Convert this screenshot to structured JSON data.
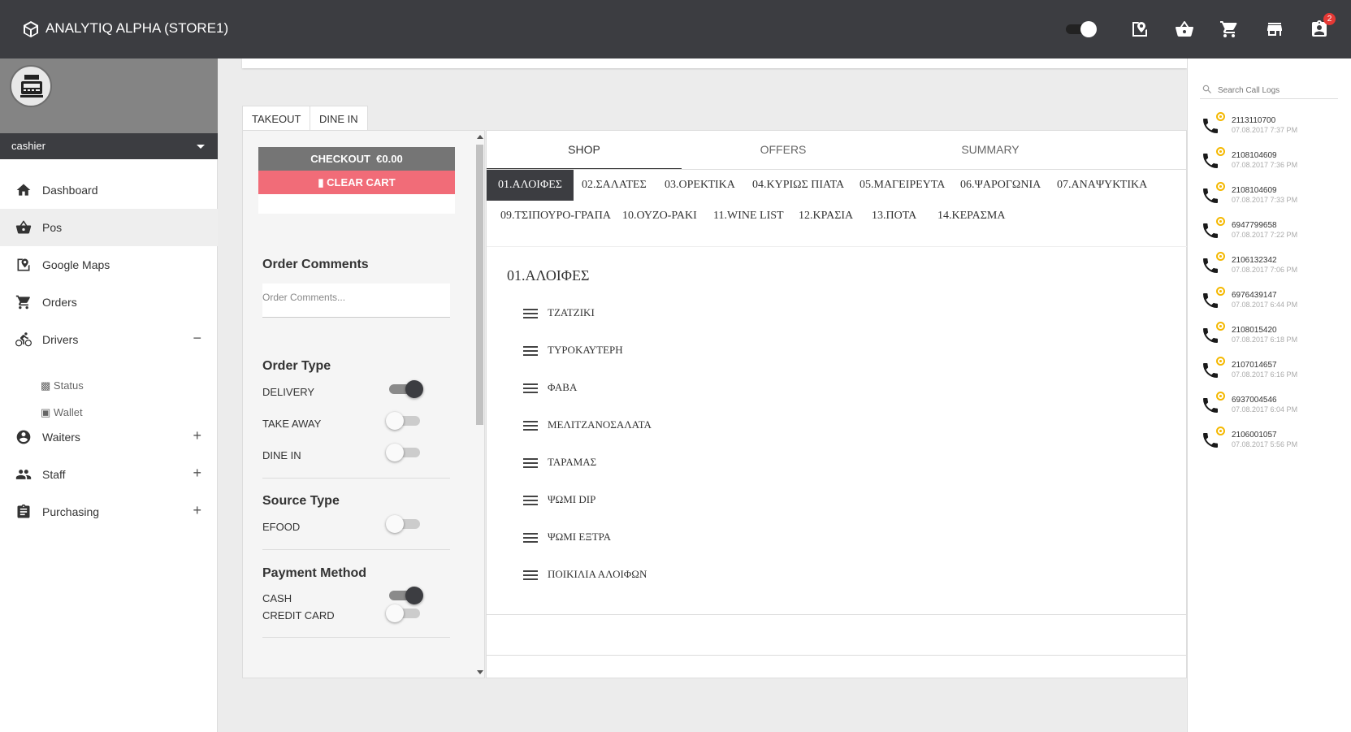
{
  "app": {
    "title": "ANALYTIQ ALPHA (STORE1)",
    "badge_count": "2"
  },
  "user": {
    "name": "cashier"
  },
  "nav": [
    {
      "label": "Dashboard",
      "icon": "home-icon",
      "toggle": ""
    },
    {
      "label": "Pos",
      "icon": "basket-icon",
      "toggle": ""
    },
    {
      "label": "Google Maps",
      "icon": "map-icon",
      "toggle": ""
    },
    {
      "label": "Orders",
      "icon": "cart-icon",
      "toggle": ""
    },
    {
      "label": "Drivers",
      "icon": "bike-icon",
      "toggle": "−"
    },
    {
      "label": "Waiters",
      "icon": "account-icon",
      "toggle": "+"
    },
    {
      "label": "Staff",
      "icon": "group-icon",
      "toggle": "+"
    },
    {
      "label": "Purchasing",
      "icon": "clipboard-icon",
      "toggle": "+"
    }
  ],
  "drivers_sub": [
    {
      "label": "Status"
    },
    {
      "label": "Wallet"
    }
  ],
  "order_tabs": [
    "TAKEOUT",
    "DINE IN"
  ],
  "cart": {
    "checkout_label": "CHECKOUT",
    "total": "€0.00",
    "clear_label": "CLEAR CART",
    "order_comments_heading": "Order Comments",
    "order_comments_placeholder": "Order Comments...",
    "order_type_heading": "Order Type",
    "order_types": [
      {
        "label": "DELIVERY",
        "on": true
      },
      {
        "label": "TAKE AWAY",
        "on": false
      },
      {
        "label": "DINE IN",
        "on": false
      }
    ],
    "source_type_heading": "Source Type",
    "source_types": [
      {
        "label": "EFOOD",
        "on": false
      }
    ],
    "payment_heading": "Payment Method",
    "payment_methods": [
      {
        "label": "CASH",
        "on": true
      },
      {
        "label": "CREDIT CARD",
        "on": false
      }
    ]
  },
  "shop_tabs": [
    "SHOP",
    "OFFERS",
    "SUMMARY"
  ],
  "categories": [
    "01.ΑΛΟΙΦΕΣ",
    "02.ΣΑΛΑΤΕΣ",
    "03.ΟΡΕΚΤΙΚΑ",
    "04.ΚΥΡΙΩΣ ΠΙΑΤΑ",
    "05.ΜΑΓΕΙΡΕΥΤΑ",
    "06.ΨΑΡΟΓΩΝΙΑ",
    "07.ΑΝΑΨΥΚΤΙΚΑ",
    "09.ΤΣΙΠΟΥΡΟ-ΓΡΑΠΑ",
    "10.ΟΥΖΟ-ΡΑΚΙ",
    "11.WINE LIST",
    "12.ΚΡΑΣΙΑ",
    "13.ΠΟΤΑ",
    "14.ΚΕΡΑΣΜΑ"
  ],
  "current_category": "01.ΑΛΟΙΦΕΣ",
  "products": [
    "ΤΖΑΤΖΙΚΙ",
    "ΤΥΡΟΚΑΥΤΕΡΗ",
    "ΦΑΒΑ",
    "ΜΕΛΙΤΖΑΝΟΣΑΛΑΤΑ",
    "ΤΑΡΑΜΑΣ",
    "ΨΩΜΙ DIP",
    "ΨΩΜΙ ΕΞΤΡΑ",
    "ΠΟΙΚΙΛΙΑ ΑΛΟΙΦΩΝ"
  ],
  "call_logs": {
    "search_placeholder": "Search Call Logs",
    "items": [
      {
        "number": "2113110700",
        "date": "07.08.2017 7:37 PM"
      },
      {
        "number": "2108104609",
        "date": "07.08.2017 7:36 PM"
      },
      {
        "number": "2108104609",
        "date": "07.08.2017 7:33 PM"
      },
      {
        "number": "6947799658",
        "date": "07.08.2017 7:22 PM"
      },
      {
        "number": "2106132342",
        "date": "07.08.2017 7:06 PM"
      },
      {
        "number": "6976439147",
        "date": "07.08.2017 6:44 PM"
      },
      {
        "number": "2108015420",
        "date": "07.08.2017 6:18 PM"
      },
      {
        "number": "2107014657",
        "date": "07.08.2017 6:16 PM"
      },
      {
        "number": "6937004546",
        "date": "07.08.2017 6:04 PM"
      },
      {
        "number": "2106001057",
        "date": "07.08.2017 5:56 PM"
      }
    ]
  },
  "colors": {
    "topbar": "#3c3d41",
    "checkout": "#757575",
    "clear_cart": "#f16c78",
    "call_status": "#f5b800"
  }
}
